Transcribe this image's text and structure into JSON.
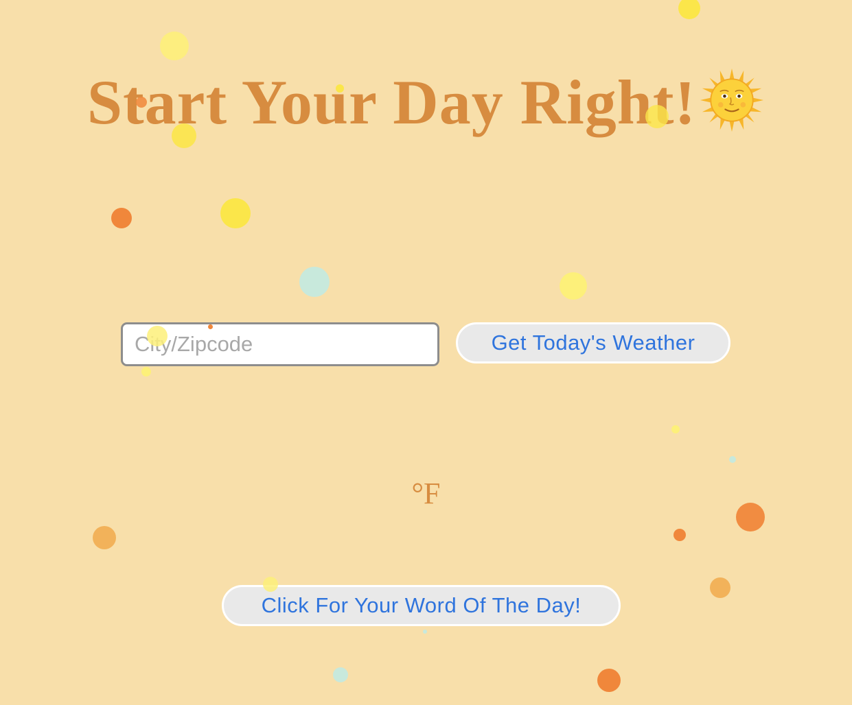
{
  "header": {
    "title": "Start Your Day Right!",
    "emoji_icon": "sun-with-face-icon"
  },
  "weather_form": {
    "city_placeholder": "City/Zipcode",
    "city_value": "",
    "submit_label": "Get Today's Weather"
  },
  "weather": {
    "temperature_unit": "°F"
  },
  "word_of_day": {
    "button_label": "Click For Your Word Of The Day!"
  },
  "colors": {
    "background": "#f8dfaa",
    "title": "#d78c40",
    "button_text": "#2f74dd",
    "confetti_yellow": "#fbe64a",
    "confetti_orange": "#f0873b",
    "confetti_mint": "#c8e9dc"
  }
}
